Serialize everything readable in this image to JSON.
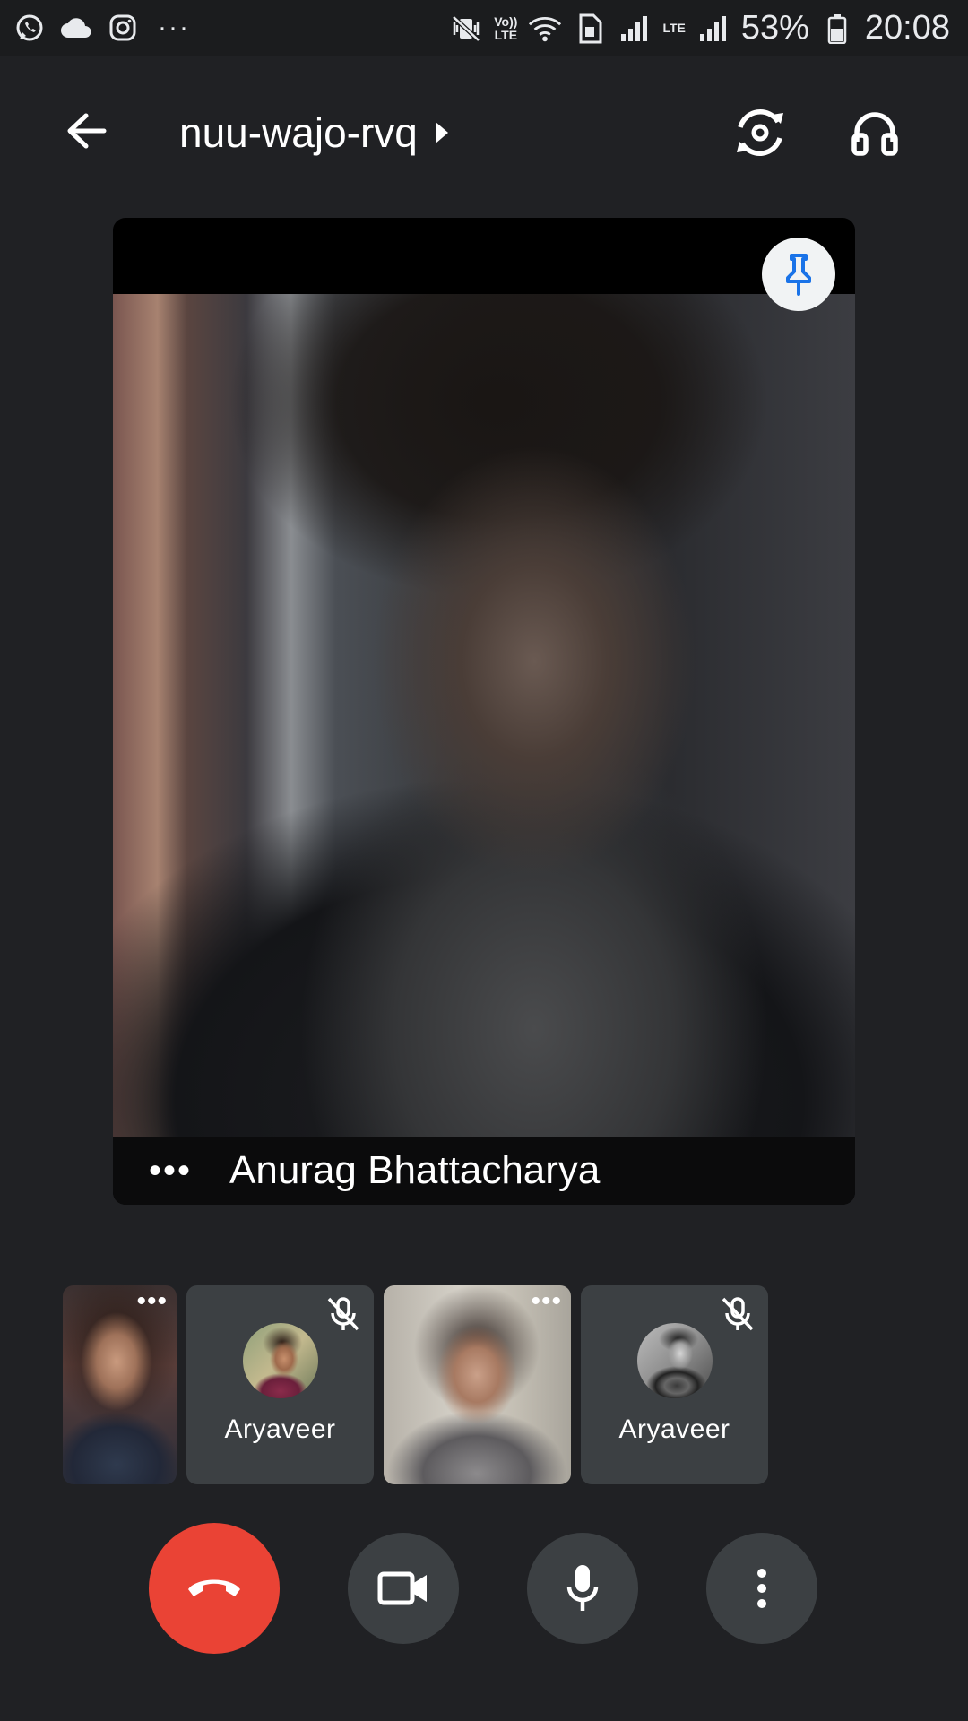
{
  "status_bar": {
    "notification_icons": [
      "whatsapp-icon",
      "cloud-icon",
      "instagram-icon"
    ],
    "more_notifications": "···",
    "volte_label_top": "Vo))",
    "volte_label_bottom": "LTE",
    "lte_label": "LTE",
    "battery_percent": "53%",
    "time": "20:08"
  },
  "top_bar": {
    "meeting_code": "nuu-wajo-rvq"
  },
  "main_tile": {
    "participant_name": "Anurag Bhattacharya",
    "more_label": "•••"
  },
  "participants": [
    {
      "type": "video",
      "more_label": "•••"
    },
    {
      "type": "audio",
      "name": "Aryaveer",
      "muted": true
    },
    {
      "type": "video",
      "more_label": "•••"
    },
    {
      "type": "audio",
      "name": "Aryaveer",
      "muted": true
    }
  ],
  "controls": {
    "end_call_color": "#ea4335",
    "button_color": "#3c4043"
  },
  "colors": {
    "background": "#202124",
    "pin_accent": "#1a73e8"
  }
}
